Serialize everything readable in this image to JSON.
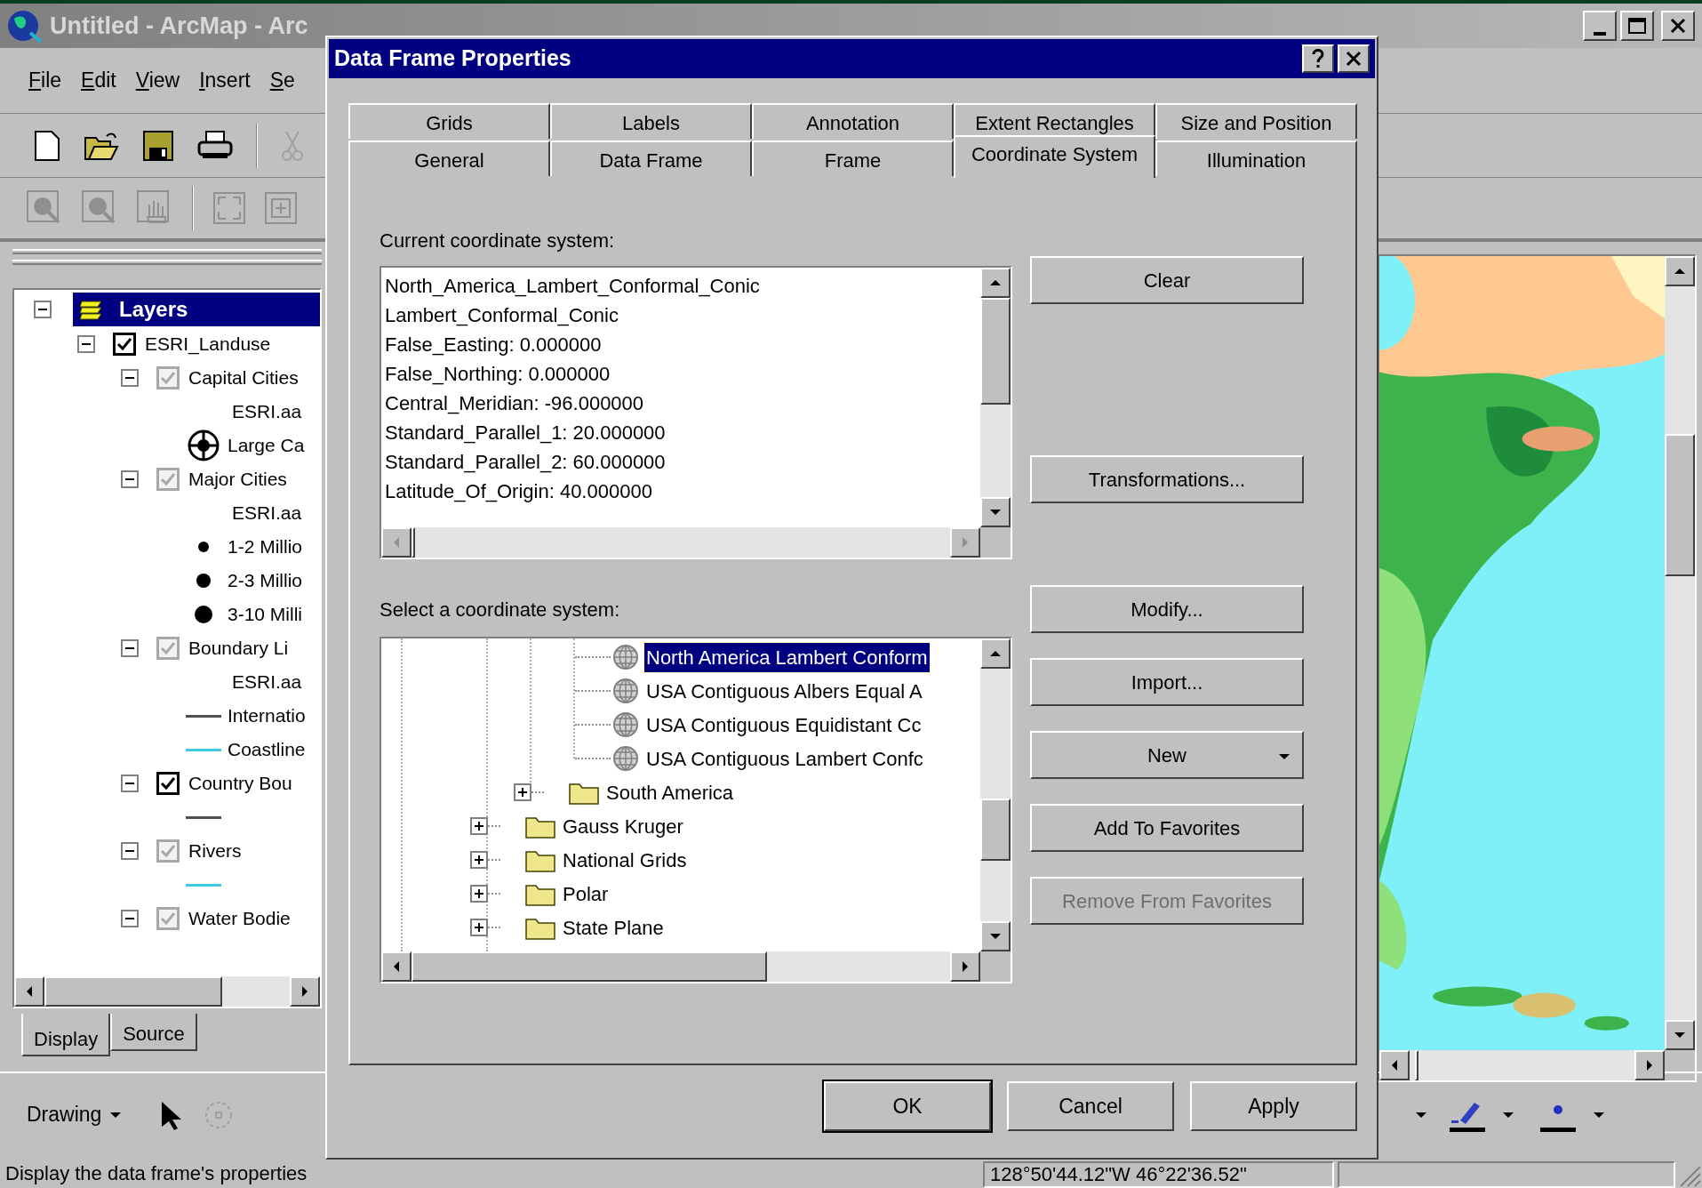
{
  "app_window": {
    "title": "Untitled - ArcMap - Arc",
    "menu": [
      "File",
      "Edit",
      "View",
      "Insert",
      "Se"
    ]
  },
  "toc": {
    "root": {
      "label": "Layers",
      "selected": true,
      "expanded": true,
      "children": [
        {
          "label": "ESRI_Landuse",
          "checked": true,
          "dimmed": false,
          "expanded": true,
          "children": [
            {
              "label": "Capital Cities",
              "checked": true,
              "dimmed": true,
              "expanded": true,
              "legend": [
                {
                  "kind": "heading",
                  "label": "ESRI.aa"
                },
                {
                  "kind": "capital",
                  "label": "Large Ca"
                }
              ]
            },
            {
              "label": "Major Cities",
              "checked": true,
              "dimmed": true,
              "expanded": true,
              "legend": [
                {
                  "kind": "heading",
                  "label": "ESRI.aa"
                },
                {
                  "kind": "dot",
                  "label": "1-2 Millio"
                },
                {
                  "kind": "dot",
                  "label": "2-3 Millio"
                },
                {
                  "kind": "dot",
                  "label": "3-10 Milli"
                }
              ]
            },
            {
              "label": "Boundary Li",
              "checked": true,
              "dimmed": true,
              "expanded": true,
              "legend": [
                {
                  "kind": "heading",
                  "label": "ESRI.aa"
                },
                {
                  "kind": "line",
                  "color": "#505050",
                  "label": "Internatio"
                },
                {
                  "kind": "line",
                  "color": "#40c8e8",
                  "label": "Coastline"
                }
              ]
            },
            {
              "label": "Country Bou",
              "checked": true,
              "dimmed": false,
              "expanded": true,
              "legend": [
                {
                  "kind": "line",
                  "color": "#505050"
                }
              ]
            },
            {
              "label": "Rivers",
              "checked": true,
              "dimmed": true,
              "expanded": true,
              "legend": [
                {
                  "kind": "line",
                  "color": "#40c8e8"
                }
              ]
            },
            {
              "label": "Water Bodie",
              "checked": true,
              "dimmed": true,
              "expanded": true
            }
          ]
        }
      ]
    }
  },
  "toc_tabs": [
    {
      "label": "Display",
      "selected": true
    },
    {
      "label": "Source",
      "selected": false
    }
  ],
  "drawing_toolbar": {
    "label": "Drawing"
  },
  "status_bar": {
    "message": "Display the data frame's properties",
    "coordinates": "128°50'44.12\"W  46°22'36.52\""
  },
  "dialog": {
    "title": "Data Frame Properties",
    "tab_rows": [
      {
        "tabs": [
          {
            "label": "Grids",
            "selected": false
          },
          {
            "label": "Labels",
            "selected": false
          },
          {
            "label": "Annotation",
            "selected": false
          },
          {
            "label": "Extent Rectangles",
            "selected": false
          },
          {
            "label": "Size and Position",
            "selected": false
          }
        ]
      },
      {
        "tabs": [
          {
            "label": "General",
            "selected": false
          },
          {
            "label": "Data Frame",
            "selected": false
          },
          {
            "label": "Frame",
            "selected": false
          },
          {
            "label": "Coordinate System",
            "selected": true
          },
          {
            "label": "Illumination",
            "selected": false
          }
        ]
      }
    ],
    "current_label": "Current coordinate system:",
    "current_lines": [
      "North_America_Lambert_Conformal_Conic",
      "Lambert_Conformal_Conic",
      "False_Easting: 0.000000",
      "False_Northing: 0.000000",
      "Central_Meridian: -96.000000",
      "Standard_Parallel_1: 20.000000",
      "Standard_Parallel_2: 60.000000",
      "Latitude_Of_Origin: 40.000000"
    ],
    "current_buttons": [
      {
        "label": "Clear",
        "disabled": false
      },
      {
        "label": "Transformations...",
        "disabled": false
      }
    ],
    "select_label": "Select a coordinate system:",
    "tree": [
      {
        "children": [
          {
            "children": [
              {
                "kind": "projection",
                "label": "North America Lambert Conform",
                "selected": true
              },
              {
                "kind": "projection",
                "label": "USA Contiguous Albers Equal A",
                "selected": false
              },
              {
                "kind": "projection",
                "label": "USA Contiguous Equidistant Cc",
                "selected": false
              },
              {
                "kind": "projection",
                "label": "USA Contiguous Lambert Confc",
                "selected": false
              }
            ]
          },
          {
            "kind": "folder",
            "label": "South America",
            "expanded": false,
            "selected": false
          }
        ]
      },
      {
        "kind": "folder",
        "label": "Gauss Kruger",
        "expanded": false,
        "selected": false
      },
      {
        "kind": "folder",
        "label": "National Grids",
        "expanded": false,
        "selected": false
      },
      {
        "kind": "folder",
        "label": "Polar",
        "expanded": false,
        "selected": false
      },
      {
        "kind": "folder",
        "label": "State Plane",
        "expanded": false,
        "selected": false
      }
    ],
    "select_buttons": [
      {
        "label": "Modify...",
        "dropdown": false,
        "disabled": false
      },
      {
        "label": "Import...",
        "dropdown": false,
        "disabled": false
      },
      {
        "label": "New",
        "dropdown": true,
        "disabled": false
      },
      {
        "label": "Add To Favorites",
        "dropdown": false,
        "disabled": false
      },
      {
        "label": "Remove From Favorites",
        "dropdown": false,
        "disabled": true
      }
    ],
    "footer_buttons": [
      {
        "label": "OK",
        "default": true
      },
      {
        "label": "Cancel",
        "default": false
      },
      {
        "label": "Apply",
        "default": false
      }
    ]
  }
}
